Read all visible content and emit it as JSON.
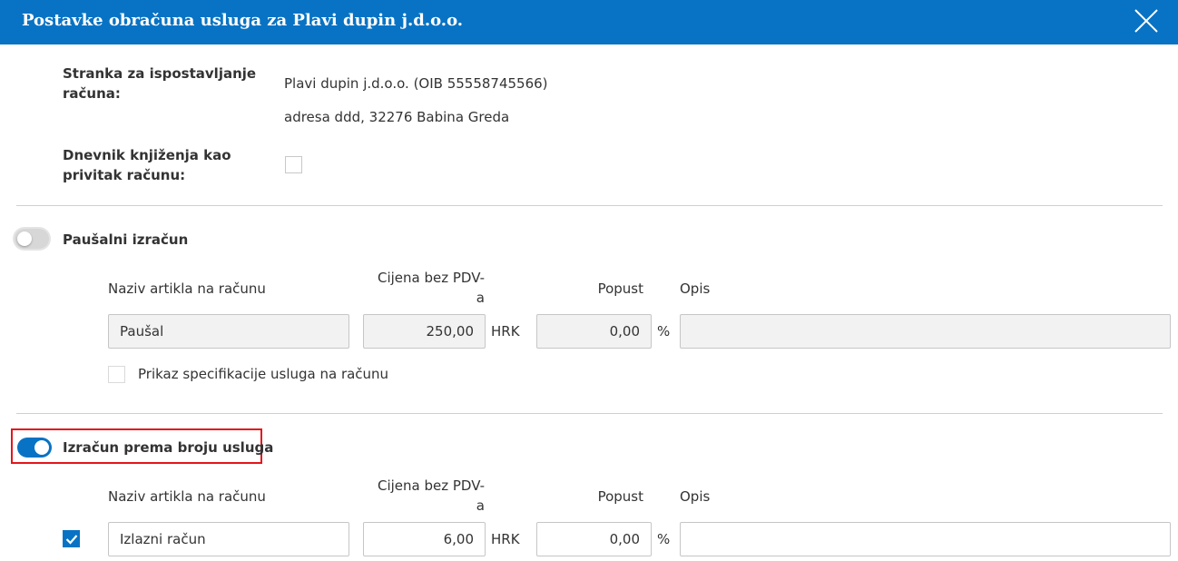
{
  "header": {
    "title": "Postavke obračuna usluga za Plavi dupin j.d.o.o.",
    "close_icon": "close-icon"
  },
  "client": {
    "label_line1": "Stranka za ispostavljanje",
    "label_line2": "računa:",
    "name": "Plavi dupin j.d.o.o. (OIB 55558745566)",
    "address": "adresa ddd, 32276 Babina Greda"
  },
  "journal": {
    "label_line1": "Dnevnik knjiženja kao",
    "label_line2": "privitak računu:",
    "checked": false
  },
  "flat": {
    "toggle_label": "Paušalni izračun",
    "enabled": false,
    "col_name": "Naziv artikla na računu",
    "col_price_line1": "Cijena bez PDV-",
    "col_price_line2": "a",
    "col_discount": "Popust",
    "col_desc": "Opis",
    "item_name": "Paušal",
    "price": "250,00",
    "currency": "HRK",
    "discount": "0,00",
    "percent": "%",
    "description": "",
    "spec_label": "Prikaz specifikacije usluga na računu",
    "spec_checked": false
  },
  "perservice": {
    "toggle_label": "Izračun prema broju usluga",
    "enabled": true,
    "col_name": "Naziv artikla na računu",
    "col_price_line1": "Cijena bez PDV-",
    "col_price_line2": "a",
    "col_discount": "Popust",
    "col_desc": "Opis",
    "rows": [
      {
        "checked": true,
        "item_name": "Izlazni račun",
        "price": "6,00",
        "currency": "HRK",
        "discount": "0,00",
        "percent": "%",
        "description": ""
      }
    ]
  },
  "colors": {
    "header_bg": "#0873c4",
    "accent": "#0873c4",
    "highlight_border": "#e2161b"
  }
}
